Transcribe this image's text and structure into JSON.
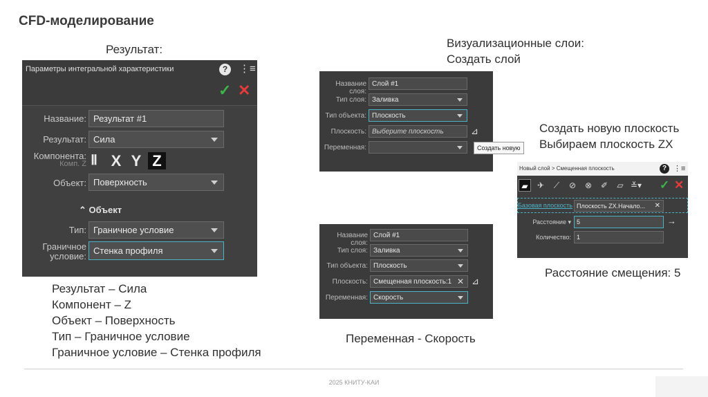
{
  "slide": {
    "title": "CFD-моделирование",
    "result_heading": "Результат:",
    "vis_heading_line1": "Визуализационные слои:",
    "vis_heading_line2": "Создать слой",
    "create_plane_line1": "Создать новую плоскость",
    "create_plane_line2": "Выбираем плоскость ZX",
    "offset_caption": "Расстояние смещения: 5",
    "variable_caption": "Переменная - Скорость",
    "summary": [
      "Результат – Сила",
      "Компонент – Z",
      "Объект – Поверхность",
      "Тип – Граничное условие",
      "Граничное условие – Стенка профиля"
    ],
    "footer": "2025 КНИТУ-КАИ"
  },
  "panel_result": {
    "title": "Параметры интегральной характеристики",
    "help_icon": "?",
    "name_label": "Название:",
    "name_value": "Результат #1",
    "result_label": "Результат:",
    "result_value": "Сила",
    "component_label": "Компонента:",
    "component_sublabel": "Комп. Z",
    "axes": [
      "X",
      "Y",
      "Z"
    ],
    "selected_axis": "Z",
    "object_label": "Объект:",
    "object_value": "Поверхность",
    "group_header": "Объект",
    "type_label": "Тип:",
    "type_value": "Граничное условие",
    "bc_label_line1": "Граничное",
    "bc_label_line2": "условие:",
    "bc_value": "Стенка профиля"
  },
  "panel_layer1": {
    "name_label": "Название слоя:",
    "name_value": "Слой #1",
    "type_label": "Тип слоя:",
    "type_value": "Заливка",
    "object_type_label": "Тип объекта:",
    "object_type_value": "Плоскость",
    "plane_label": "Плоскость:",
    "plane_placeholder": "Выберите плоскость",
    "variable_label": "Переменная:",
    "variable_value": "",
    "tooltip": "Создать новую"
  },
  "panel_layer2": {
    "name_label": "Название слоя:",
    "name_value": "Слой #1",
    "type_label": "Тип слоя:",
    "type_value": "Заливка",
    "object_type_label": "Тип объекта:",
    "object_type_value": "Плоскость",
    "plane_label": "Плоскость:",
    "plane_value": "Смещенная плоскость:1",
    "variable_label": "Переменная:",
    "variable_value": "Скорость"
  },
  "panel_plane": {
    "title": "Новый слой > Смещенная плоскость",
    "base_label": "Базовая плоскость",
    "base_value": "Плоскость ZX.Начало...",
    "distance_label": "Расстояние",
    "distance_value": "5",
    "count_label": "Количество:",
    "count_value": "1"
  },
  "colors": {
    "panel_bg": "#404040",
    "accent": "#4fb3c8",
    "ok": "#3cb54a",
    "cancel": "#e53b3b"
  }
}
